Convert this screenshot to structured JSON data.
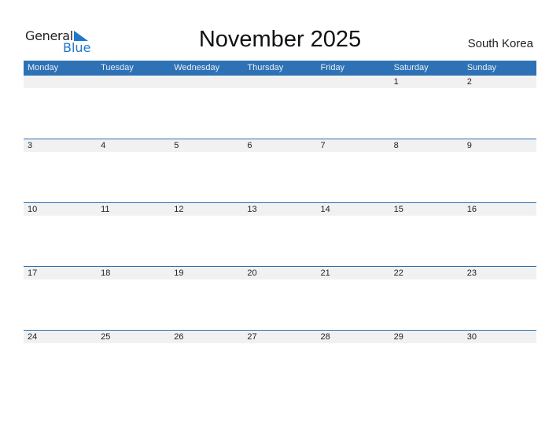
{
  "logo": {
    "word1": "General",
    "word2": "Blue"
  },
  "title": "November 2025",
  "country": "South Korea",
  "weekdays": [
    "Monday",
    "Tuesday",
    "Wednesday",
    "Thursday",
    "Friday",
    "Saturday",
    "Sunday"
  ],
  "weeks": [
    [
      "",
      "",
      "",
      "",
      "",
      "1",
      "2"
    ],
    [
      "3",
      "4",
      "5",
      "6",
      "7",
      "8",
      "9"
    ],
    [
      "10",
      "11",
      "12",
      "13",
      "14",
      "15",
      "16"
    ],
    [
      "17",
      "18",
      "19",
      "20",
      "21",
      "22",
      "23"
    ],
    [
      "24",
      "25",
      "26",
      "27",
      "28",
      "29",
      "30"
    ]
  ],
  "colors": {
    "accent": "#2e72b5",
    "logo_blue": "#1f78c8",
    "day_bar": "#f1f1f1"
  }
}
